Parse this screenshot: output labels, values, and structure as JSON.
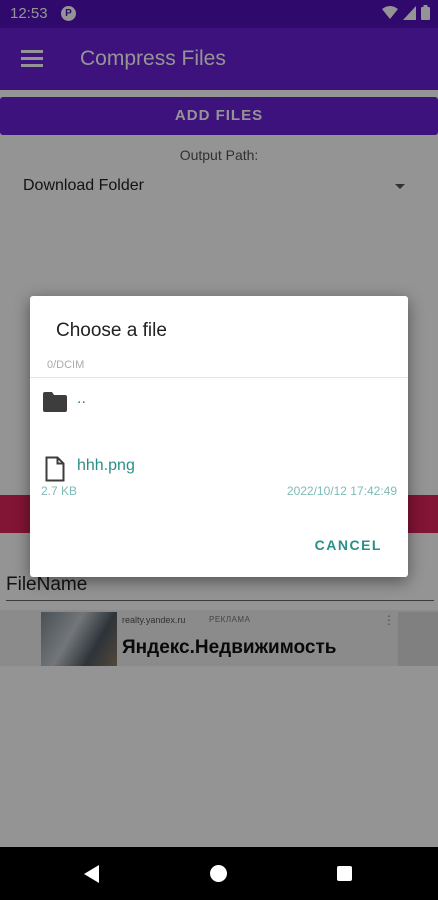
{
  "status_bar": {
    "time": "12:53",
    "app_badge": "P",
    "icons": [
      "wifi-icon",
      "signal-icon",
      "battery-icon"
    ]
  },
  "app_bar": {
    "title": "Compress Files",
    "menu_icon": "hamburger-menu-icon"
  },
  "main": {
    "add_files_label": "ADD FILES",
    "output_path_label": "Output Path:",
    "output_path_value": "Download Folder",
    "filename_label": "FileName"
  },
  "ad": {
    "domain": "realty.yandex.ru",
    "tag": "РЕКЛАМА",
    "title": "Яндекс.Недвижимость",
    "more_icon": "⋮"
  },
  "dialog": {
    "title": "Choose a file",
    "path": "0/DCIM",
    "items": [
      {
        "type": "folder",
        "name": ".."
      },
      {
        "type": "file",
        "name": "hhh.png",
        "size": "2.7 KB",
        "date": "2022/10/12 17:42:49"
      }
    ],
    "cancel_label": "CANCEL"
  },
  "colors": {
    "primary": "#6a1fd6",
    "status_bar": "#5211b8",
    "accent_pink": "#e0245c",
    "teal": "#2a8f86"
  }
}
